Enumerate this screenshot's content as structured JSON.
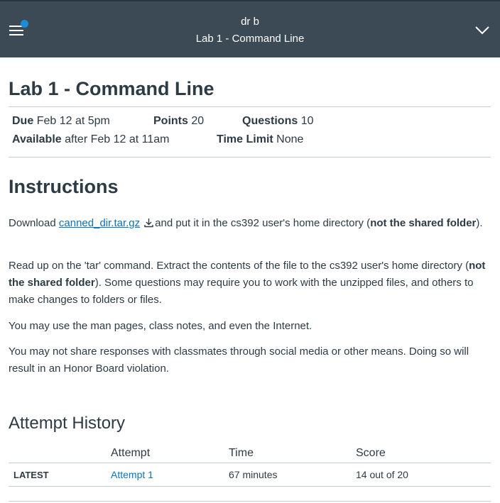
{
  "topbar": {
    "course_name": "dr b",
    "page_title": "Lab 1 - Command Line",
    "menu_icon": "hamburger-icon",
    "notification_color": "#1a8cd8",
    "expand_icon": "chevron-down-icon"
  },
  "quiz": {
    "title": "Lab 1 - Command Line",
    "due_label": "Due",
    "due_value": "Feb 12 at 5pm",
    "points_label": "Points",
    "points_value": "20",
    "questions_label": "Questions",
    "questions_value": "10",
    "available_label": "Available",
    "available_value": "after Feb 12 at 11am",
    "time_limit_label": "Time Limit",
    "time_limit_value": "None"
  },
  "instructions": {
    "heading": "Instructions",
    "p1_before": "Download",
    "p1_link": "canned_dir.tar.gz",
    "p1_after": "and put it in the cs392 user's home directory (",
    "p1_bold": "not the shared folder",
    "p1_end": ").",
    "p2_before": "Read up on the 'tar' command.  Extract the contents of the file to the cs392 user's home directory (",
    "p2_bold": "not the shared folder",
    "p2_after": ").  Some questions may require you to work with the unzipped files, and others to make changes to folders or files.",
    "p3": "You may use the man pages, class notes, and even the Internet.",
    "p4": "You may not share responses with classmates through social media or other means. Doing so will result in an Honor Board violation."
  },
  "history": {
    "heading": "Attempt History",
    "columns": [
      "",
      "Attempt",
      "Time",
      "Score"
    ],
    "rows": [
      {
        "label": "LATEST",
        "attempt": "Attempt 1",
        "time": "67 minutes",
        "score": "14 out of 20"
      }
    ]
  }
}
